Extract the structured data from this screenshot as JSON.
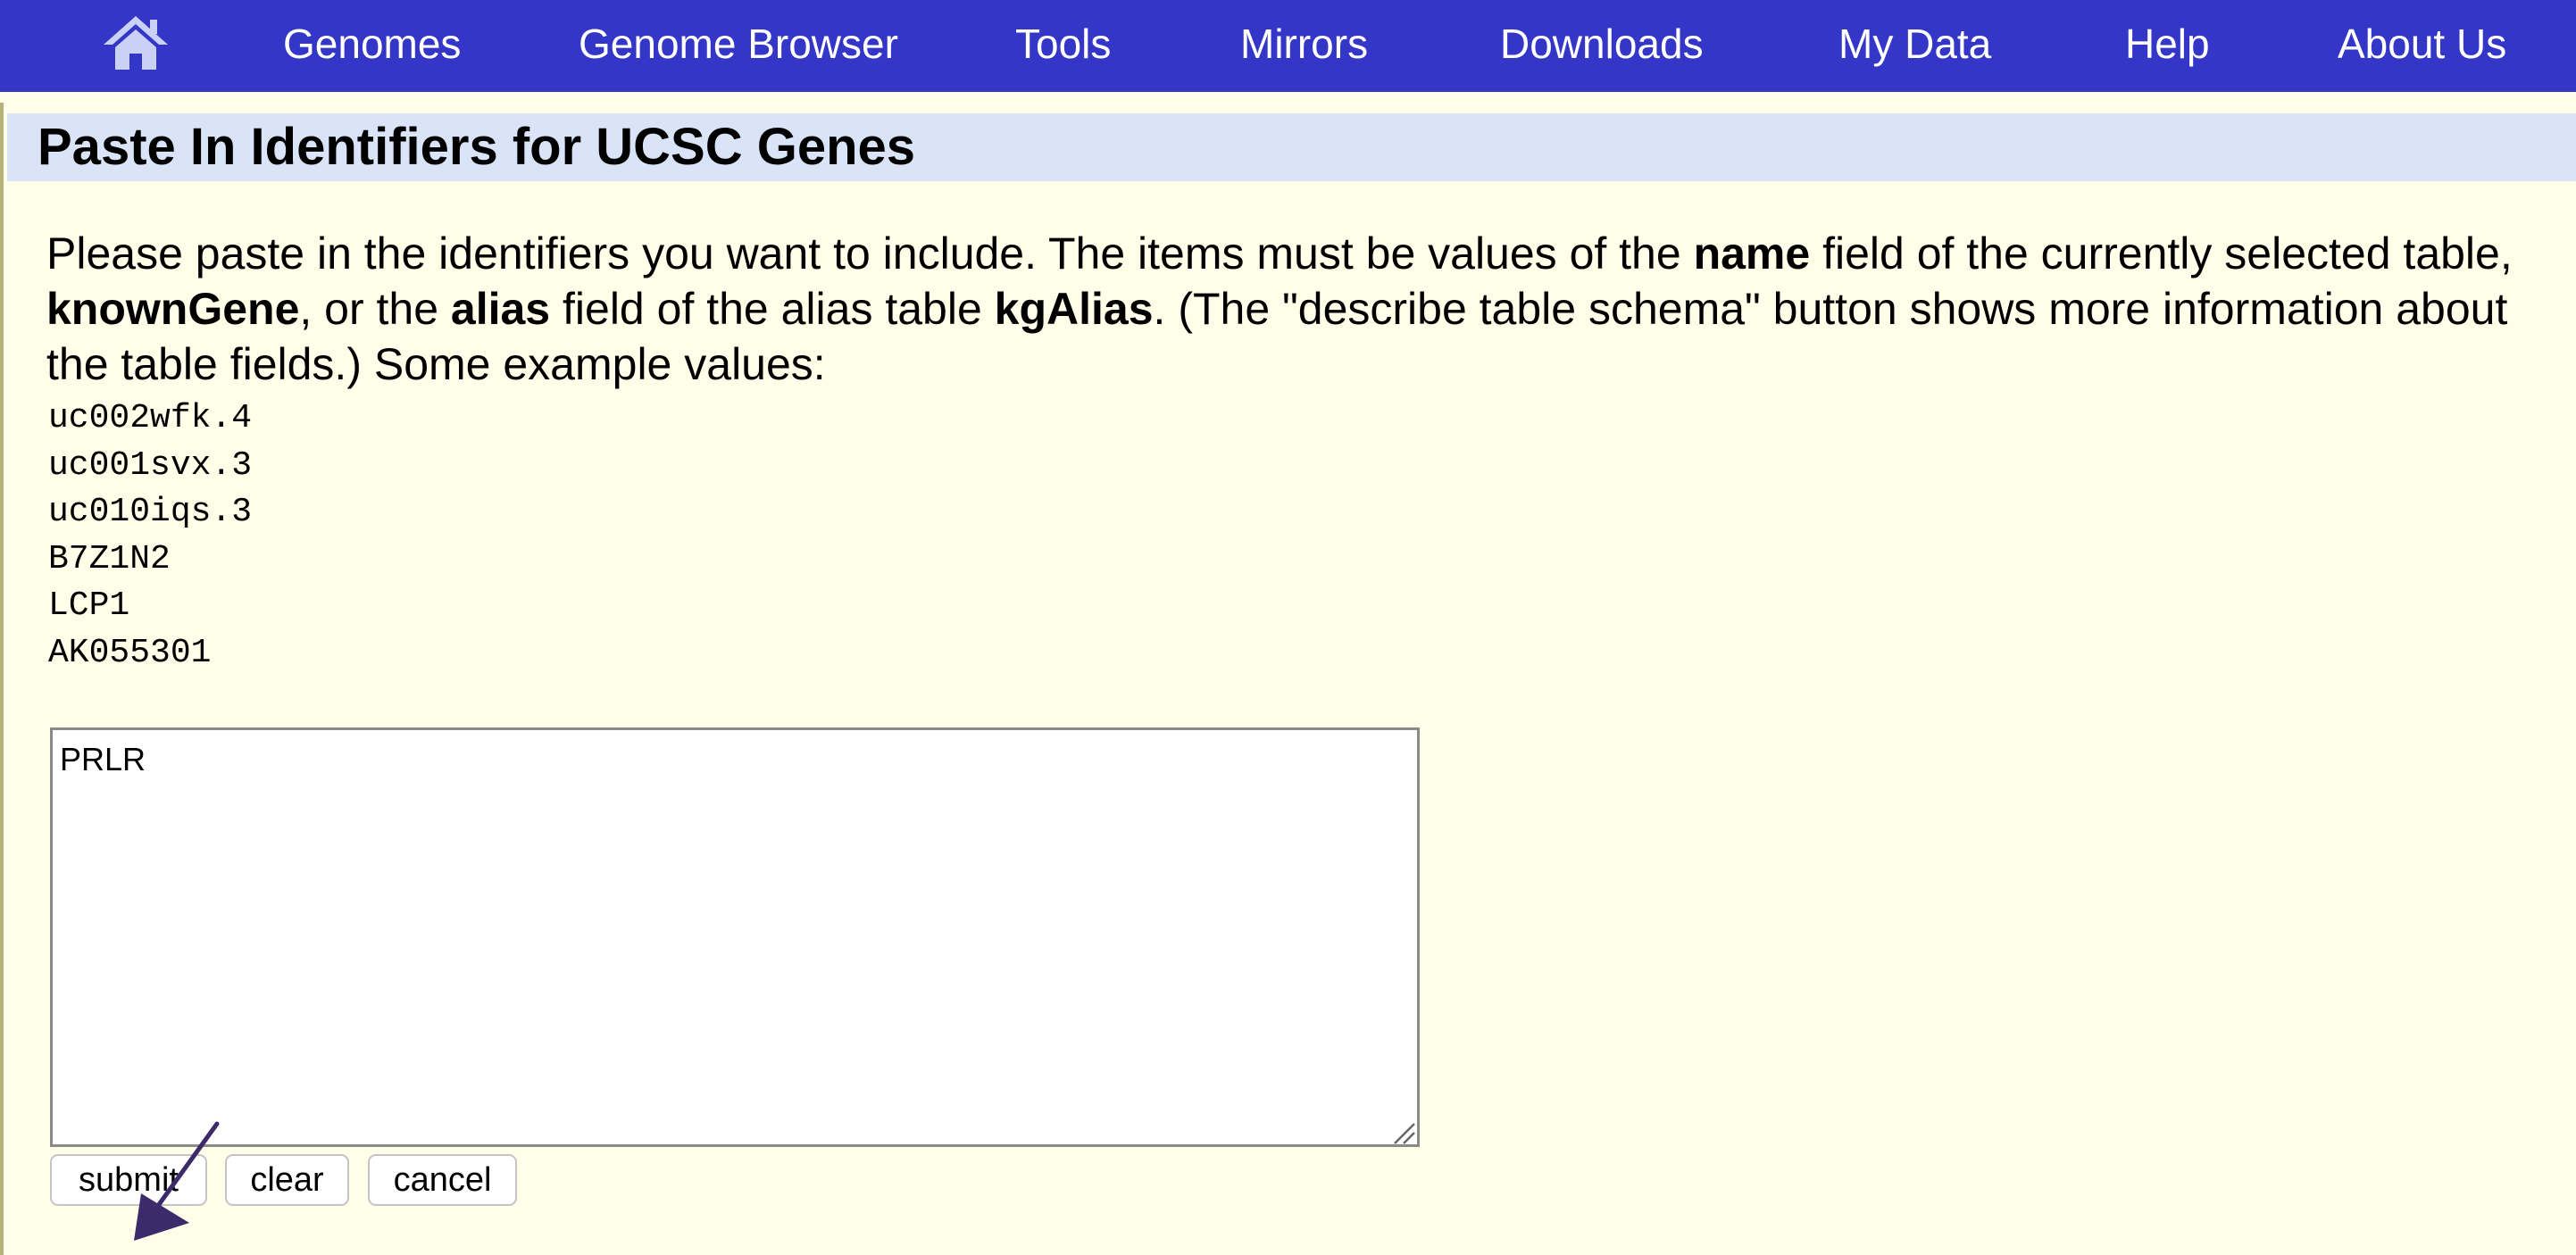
{
  "nav": {
    "home_icon": "home-icon",
    "items": [
      {
        "label": "Genomes"
      },
      {
        "label": "Genome Browser"
      },
      {
        "label": "Tools"
      },
      {
        "label": "Mirrors"
      },
      {
        "label": "Downloads"
      },
      {
        "label": "My Data"
      },
      {
        "label": "Help"
      },
      {
        "label": "About Us"
      }
    ],
    "background_color": "#3436c8"
  },
  "page": {
    "title": "Paste In Identifiers for UCSC Genes",
    "description": {
      "p1": "Please paste in the identifiers you want to include. The items must be values of the ",
      "b1": "name",
      "p2": " field of the currently selected table, ",
      "b2": "knownGene",
      "p3": ", or the ",
      "b3": "alias",
      "p4": " field of the alias table ",
      "b4": "kgAlias",
      "p5": ". (The \"describe table schema\" button shows more information about the table fields.) Some example values:"
    },
    "examples": [
      "uc002wfk.4",
      "uc001svx.3",
      "uc010iqs.3",
      "B7Z1N2",
      "LCP1",
      "AK055301"
    ],
    "paste_value": "PRLR",
    "buttons": {
      "submit": "submit",
      "clear": "clear",
      "cancel": "cancel"
    },
    "background_color": "#fffee8",
    "title_bar_color": "#d9e4f8"
  }
}
